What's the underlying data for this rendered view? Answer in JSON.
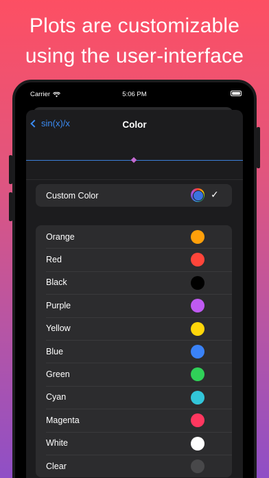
{
  "headline": {
    "line1": "Plots are customizable",
    "line2": "using the user-interface"
  },
  "status_bar": {
    "carrier": "Carrier",
    "time": "5:06 PM"
  },
  "nav": {
    "back_label": "sin(x)/x",
    "title": "Color"
  },
  "custom": {
    "label": "Custom Color",
    "selected_color": "#3b72e0",
    "checked": true,
    "check_glyph": "✓"
  },
  "colors": [
    {
      "label": "Orange",
      "hex": "#ff9f0a"
    },
    {
      "label": "Red",
      "hex": "#ff453a"
    },
    {
      "label": "Black",
      "hex": "#000000"
    },
    {
      "label": "Purple",
      "hex": "#bf5af2"
    },
    {
      "label": "Yellow",
      "hex": "#ffd60a"
    },
    {
      "label": "Blue",
      "hex": "#3a82f7"
    },
    {
      "label": "Green",
      "hex": "#30d158"
    },
    {
      "label": "Cyan",
      "hex": "#32c5d9"
    },
    {
      "label": "Magenta",
      "hex": "#ff375f"
    },
    {
      "label": "White",
      "hex": "#ffffff"
    },
    {
      "label": "Clear",
      "hex": "#48484a"
    }
  ],
  "theme": {
    "accent": "#3b8cf5",
    "preview_line": "#3b7fd9",
    "preview_marker": "#c46ad0"
  }
}
